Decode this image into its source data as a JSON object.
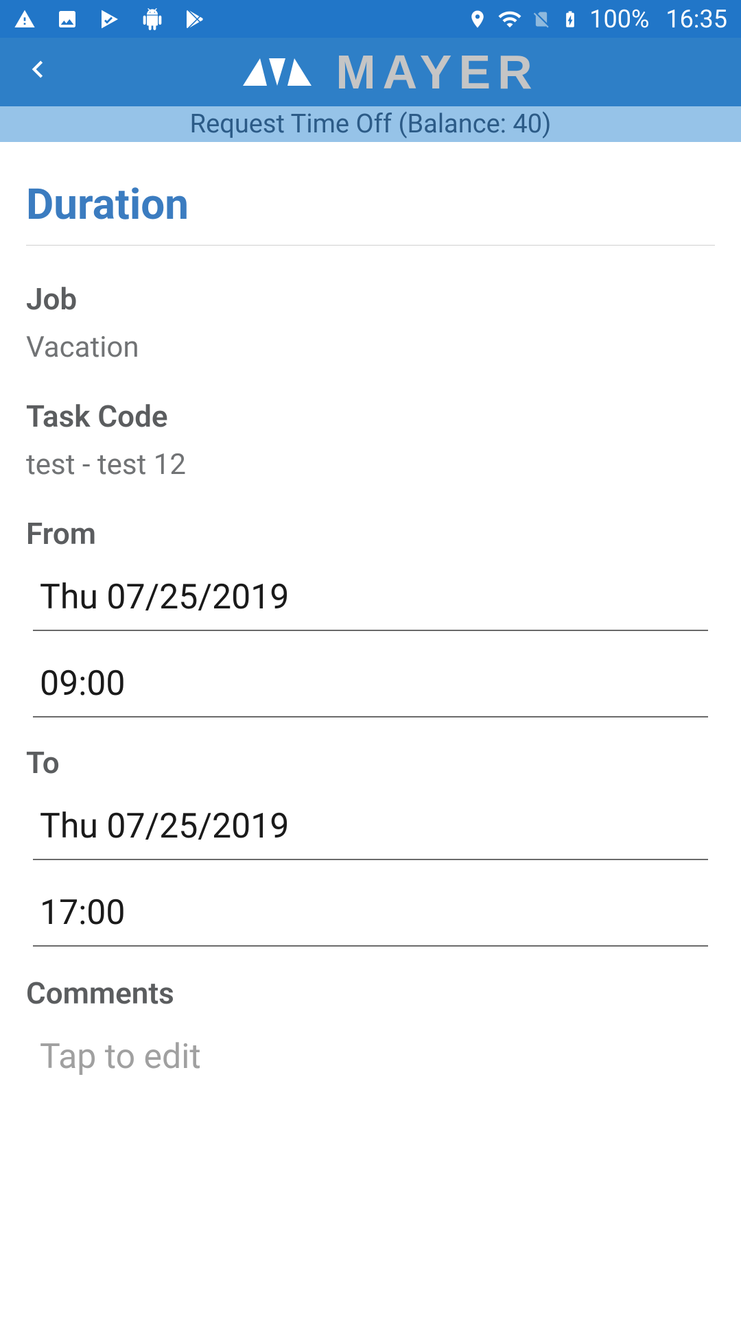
{
  "status_bar": {
    "battery_pct": "100%",
    "time": "16:35"
  },
  "header": {
    "brand": "MAYER"
  },
  "sub_header": {
    "text": "Request Time Off (Balance: 40)"
  },
  "main": {
    "section_title": "Duration",
    "job": {
      "label": "Job",
      "value": "Vacation"
    },
    "task_code": {
      "label": "Task Code",
      "value": "test - test 12"
    },
    "from": {
      "label": "From",
      "date": "Thu 07/25/2019",
      "time": "09:00"
    },
    "to": {
      "label": "To",
      "date": "Thu 07/25/2019",
      "time": "17:00"
    },
    "comments": {
      "label": "Comments",
      "placeholder": "Tap to edit"
    }
  }
}
